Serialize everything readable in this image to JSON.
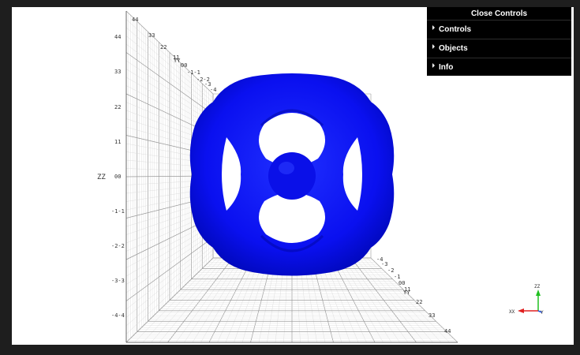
{
  "gui": {
    "close_label": "Close Controls",
    "folders": [
      {
        "label": "Controls"
      },
      {
        "label": "Objects"
      },
      {
        "label": "Info"
      }
    ]
  },
  "axes": {
    "z_name": "ZZ",
    "z_ticks": [
      "44",
      "33",
      "22",
      "11",
      "00",
      "-1-1",
      "-2-2",
      "-3-3",
      "-4-4"
    ],
    "back_ticks": [
      "44",
      "33",
      "22",
      "11",
      "00",
      "-1-1",
      "-2-2",
      "-3",
      "-4"
    ],
    "back_label": "YY",
    "front_ticks": [
      "-4",
      "-3",
      "-2",
      "-1",
      "00",
      "11",
      "22",
      "33",
      "44"
    ],
    "front_label": "YY",
    "mid_tick_top": "44",
    "mid_tick_right": "-4-4"
  },
  "triad": {
    "z": "ZZ",
    "x": "XX",
    "y": "Y"
  },
  "colors": {
    "surface": "#0a10f0",
    "surface_shadow": "#0008a8",
    "gui_bg": "#000000",
    "axis_x": "#e02020",
    "axis_y": "#20c020",
    "axis_z": "#2050e0"
  }
}
